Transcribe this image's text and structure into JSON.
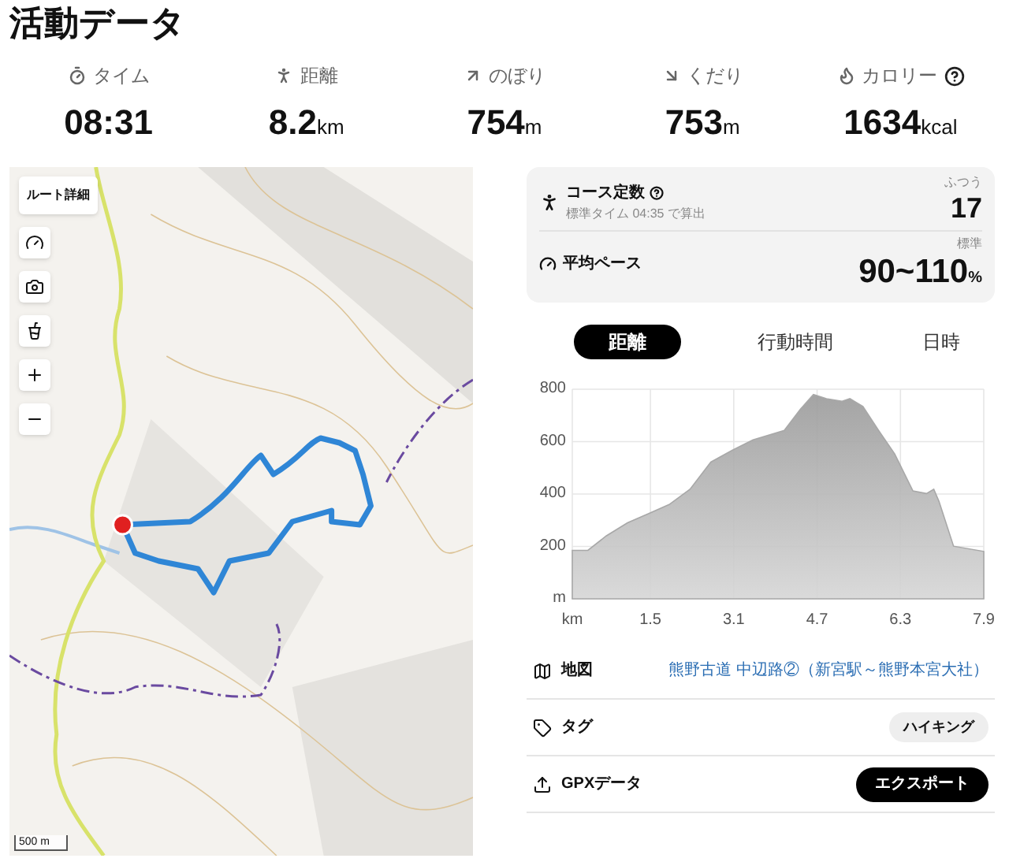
{
  "title": "活動データ",
  "stats": [
    {
      "kind": "timer",
      "label": "タイム",
      "value": "08:31",
      "help": false
    },
    {
      "kind": "walk",
      "label": "距離",
      "value": "8.2",
      "unit": "km",
      "help": false
    },
    {
      "kind": "up",
      "label": "のぼり",
      "value": "754",
      "unit": "m",
      "help": false
    },
    {
      "kind": "down",
      "label": "くだり",
      "value": "753",
      "unit": "m",
      "help": false
    },
    {
      "kind": "fire",
      "label": "カロリー",
      "value": "1634",
      "unit": "kcal",
      "help": true
    }
  ],
  "map": {
    "controls": [
      {
        "kind": "text",
        "label": "ルート詳細"
      },
      {
        "kind": "gauge"
      },
      {
        "kind": "camera"
      },
      {
        "kind": "cup"
      },
      {
        "kind": "zoom_in"
      },
      {
        "kind": "zoom_out"
      }
    ],
    "scale": "500 m"
  },
  "course": {
    "label": "コース定数",
    "note": "標準タイム 04:35 で算出",
    "rating": "ふつう",
    "value": "17"
  },
  "pace": {
    "label": "平均ペース",
    "rating": "標準",
    "value": "90~110",
    "unit": "%"
  },
  "tabs": [
    {
      "label": "距離",
      "selected": true
    },
    {
      "label": "行動時間",
      "selected": false
    },
    {
      "label": "日時",
      "selected": false
    }
  ],
  "chart_data": {
    "type": "area",
    "grid": true,
    "xlim": [
      0,
      7.9
    ],
    "ylim": [
      0,
      800
    ],
    "xticks": [
      {
        "value": 0,
        "label": "km"
      },
      1.5,
      3.1,
      4.7,
      6.3,
      7.9
    ],
    "yticks": [
      {
        "value": 0,
        "label": "m"
      },
      200,
      400,
      600,
      800
    ],
    "x": [
      0,
      0.3,
      0.65,
      1.06,
      1.46,
      1.86,
      2.26,
      2.66,
      3.07,
      3.47,
      4.07,
      4.38,
      4.63,
      4.88,
      5.18,
      5.33,
      5.58,
      5.88,
      6.19,
      6.54,
      6.8,
      6.94,
      7.04,
      7.32,
      7.9
    ],
    "series": [
      {
        "color": "#a8a8a8",
        "values": [
          185,
          185,
          240,
          290,
          325,
          360,
          418,
          522,
          567,
          607,
          643,
          724,
          780,
          764,
          754,
          764,
          734,
          643,
          553,
          412,
          402,
          418,
          372,
          201,
          181
        ]
      }
    ]
  },
  "rows": [
    {
      "kind": "link",
      "label": "地図",
      "value": "熊野古道 中辺路②（新宮駅～熊野本宮大社）"
    },
    {
      "kind": "tag",
      "label": "タグ",
      "value": "ハイキング"
    },
    {
      "kind": "button",
      "label": "GPXデータ",
      "value": "エクスポート"
    }
  ]
}
